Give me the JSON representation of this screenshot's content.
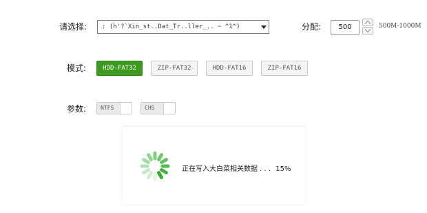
{
  "select_row": {
    "label": "请选择:",
    "selected_value": ": (h'?`Xin_st..Dat_Tr..ller_.. ~ ^1^)"
  },
  "size_row": {
    "label": "分配:",
    "value": "500",
    "range_text": "500M-1000M"
  },
  "mode_row": {
    "label": "模式:",
    "options": [
      {
        "label": "HDD-FAT32",
        "active": true
      },
      {
        "label": "ZIP-FAT32",
        "active": false
      },
      {
        "label": "HDD-FAT16",
        "active": false
      },
      {
        "label": "ZIP-FAT16",
        "active": false
      }
    ]
  },
  "params_row": {
    "label": "参数:",
    "toggles": [
      {
        "label": "NTFS",
        "on": false
      },
      {
        "label": "CHS",
        "on": false
      }
    ]
  },
  "progress": {
    "status_text": "正在写入大白菜相关数据 . . .",
    "percent_text": "15%",
    "percent": 15
  },
  "colors": {
    "accent_green": "#3c9a1f",
    "spinner_green": "#2fae2f"
  }
}
